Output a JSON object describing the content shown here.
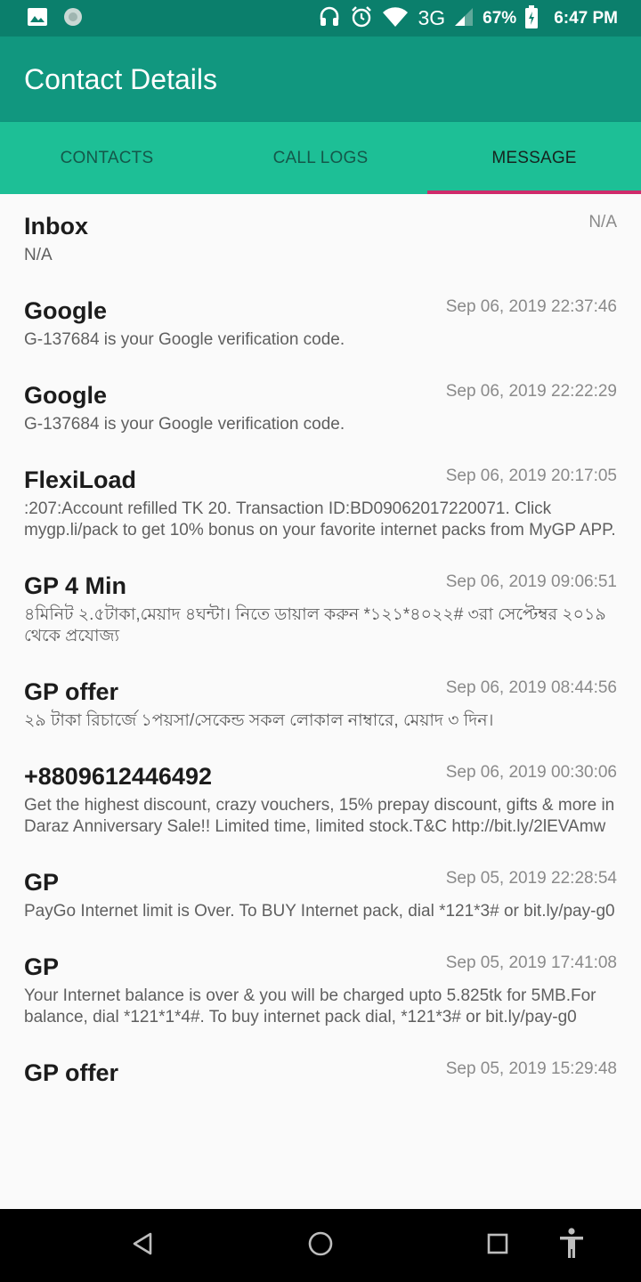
{
  "status_bar": {
    "network": "3G",
    "battery": "67%",
    "time": "6:47 PM",
    "icons": [
      "image-icon",
      "sync-icon",
      "headset-icon",
      "alarm-icon",
      "wifi-icon",
      "signal-icon",
      "battery-icon"
    ]
  },
  "app_bar": {
    "title": "Contact Details"
  },
  "tabs": [
    {
      "label": "CONTACTS",
      "active": false
    },
    {
      "label": "CALL LOGS",
      "active": false
    },
    {
      "label": "MESSAGE",
      "active": true
    }
  ],
  "colors": {
    "status_bar": "#0b7f6c",
    "app_bar": "#11977f",
    "tab_bar": "#1dbf96",
    "tab_indicator": "#cf2b6b"
  },
  "messages": [
    {
      "sender": "Inbox",
      "date": "N/A",
      "body": "N/A"
    },
    {
      "sender": "Google",
      "date": "Sep 06, 2019 22:37:46",
      "body": "G-137684 is your Google verification code."
    },
    {
      "sender": "Google",
      "date": "Sep 06, 2019 22:22:29",
      "body": "G-137684 is your Google verification code."
    },
    {
      "sender": "FlexiLoad",
      "date": "Sep 06, 2019 20:17:05",
      "body": ":207:Account refilled TK 20. Transaction ID:BD09062017220071. Click mygp.li/pack to get 10% bonus on your favorite internet packs from MyGP APP."
    },
    {
      "sender": "GP 4 Min",
      "date": "Sep 06, 2019 09:06:51",
      "body": "৪মিনিট ২.৫টাকা,মেয়াদ ৪ঘন্টা। নিতে ডায়াল করুন *১২১*৪০২২#  ৩রা সেপ্টেম্বর ২০১৯ থেকে প্রযোজ্য"
    },
    {
      "sender": "GP offer",
      "date": "Sep 06, 2019 08:44:56",
      "body": "২৯ টাকা রিচার্জে ১পয়সা/সেকেন্ড সকল লোকাল নাম্বারে, মেয়াদ ৩ দিন।"
    },
    {
      "sender": "+8809612446492",
      "date": "Sep 06, 2019 00:30:06",
      "body": "Get the highest discount, crazy vouchers, 15% prepay discount, gifts & more in Daraz Anniversary Sale!! Limited time, limited stock.T&C http://bit.ly/2lEVAmw"
    },
    {
      "sender": "GP",
      "date": "Sep 05, 2019 22:28:54",
      "body": "PayGo Internet limit is Over. To BUY Internet pack, dial *121*3# or bit.ly/pay-g0"
    },
    {
      "sender": "GP",
      "date": "Sep 05, 2019 17:41:08",
      "body": "Your Internet balance is over & you will be charged upto 5.825tk for 5MB.For balance, dial *121*1*4#. To buy internet pack dial, *121*3# or bit.ly/pay-g0"
    },
    {
      "sender": "GP offer",
      "date": "Sep 05, 2019 15:29:48",
      "body": ""
    }
  ],
  "nav_bar": {
    "icons": [
      "back-icon",
      "home-icon",
      "recents-icon",
      "accessibility-icon"
    ]
  }
}
